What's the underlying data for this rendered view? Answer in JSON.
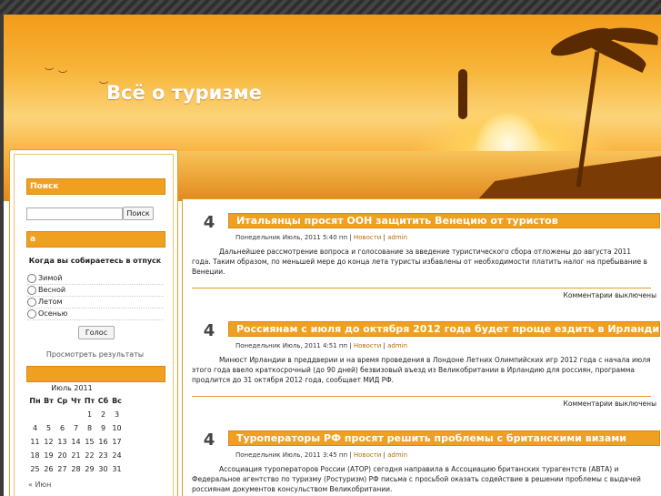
{
  "site": {
    "title": "Всё о туризме"
  },
  "sidebar": {
    "search": {
      "title": "Поиск",
      "placeholder": "",
      "button": "Поиск"
    },
    "poll": {
      "title": "а",
      "question": "Когда вы собираетесь в отпуск",
      "options": [
        "Зимой",
        "Весной",
        "Летом",
        "Осенью"
      ],
      "vote_button": "Голос",
      "results_link": "Просмотреть результаты"
    },
    "calendar": {
      "title": "",
      "caption": "Июль 2011",
      "weekdays": [
        "Пн",
        "Вт",
        "Ср",
        "Чт",
        "Пт",
        "Сб",
        "Вс"
      ],
      "weeks": [
        [
          "",
          "",
          "",
          "",
          "1",
          "2",
          "3"
        ],
        [
          "4",
          "5",
          "6",
          "7",
          "8",
          "9",
          "10"
        ],
        [
          "11",
          "12",
          "13",
          "14",
          "15",
          "16",
          "17"
        ],
        [
          "18",
          "19",
          "20",
          "21",
          "22",
          "23",
          "24"
        ],
        [
          "25",
          "26",
          "27",
          "28",
          "29",
          "30",
          "31"
        ]
      ],
      "prev_link": "« Июн"
    }
  },
  "posts": [
    {
      "day": "4",
      "title": "Итальянцы просят ООН защитить Венецию от туристов",
      "date": "Понедельник Июль, 2011 5:40 пп",
      "category": "Новости",
      "author": "admin",
      "body": "Дальнейшее рассмотрение вопроса и голосование за введение туристического сбора отложены до августа 2011 года. Таким образом, по меньшей мере до конца лета туристы избавлены от необходимости платить налог на пребывание в Венеции.",
      "comments": "Комментарии выключены"
    },
    {
      "day": "4",
      "title": "Россиянам с июля до октября 2012 года будет проще ездить в Ирландию",
      "date": "Понедельник Июль, 2011 4:51 пп",
      "category": "Новости",
      "author": "admin",
      "body": "Минюст Ирландии в преддверии и на время проведения в Лондоне Летних Олимпийских игр 2012 года с начала июля этого года ввело краткосрочный (до 90 дней) безвизовый въезд из Великобритании в Ирландию для россиян, программа продлится до 31 октября 2012 года, сообщает МИД РФ.",
      "comments": "Комментарии выключены"
    },
    {
      "day": "4",
      "title": "Туроператоры РФ просят решить проблемы с британскими визами",
      "date": "Понедельник Июль, 2011 3:45 пп",
      "category": "Новости",
      "author": "admin",
      "body": "Ассоциация туроператоров России (АТОР) сегодня направила в Ассоциацию британских турагентств (АВТА) и Федеральное агентство по туризму (Ростуризм) РФ письма с просьбой оказать содействие в решении проблемы с выдачей россиянам документов консульством Великобритании.",
      "comments": ""
    }
  ],
  "colors": {
    "accent": "#f0a020",
    "border": "#e49a2a"
  }
}
